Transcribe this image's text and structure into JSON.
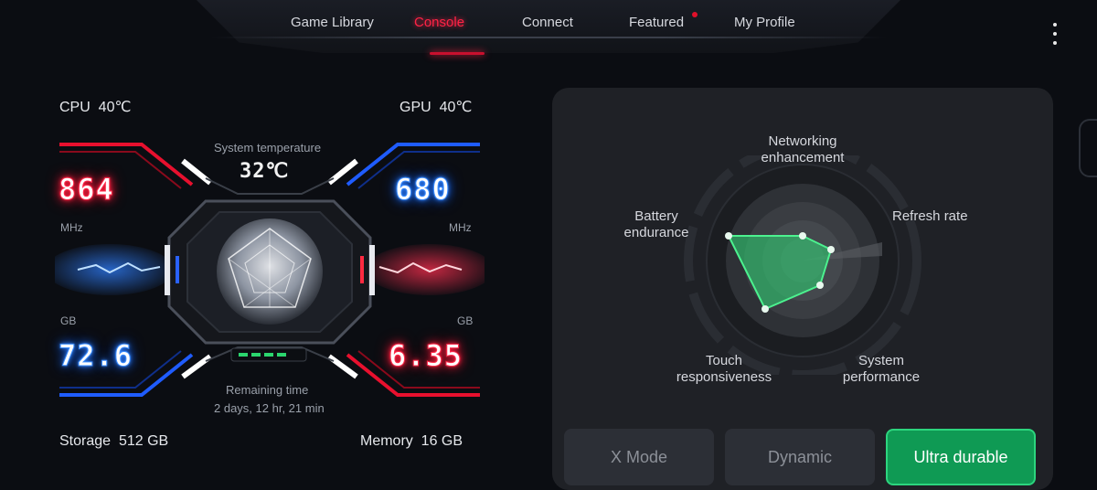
{
  "nav": {
    "tabs": [
      {
        "label": "Game Library"
      },
      {
        "label": "Console"
      },
      {
        "label": "Connect"
      },
      {
        "label": "Featured"
      },
      {
        "label": "My Profile"
      }
    ],
    "active_tab": "Console"
  },
  "dashboard": {
    "cpu": {
      "label": "CPU",
      "temp": "40℃",
      "freq": "864",
      "unit": "MHz"
    },
    "gpu": {
      "label": "GPU",
      "temp": "40℃",
      "freq": "680",
      "unit": "MHz"
    },
    "system_temp": {
      "label": "System temperature",
      "value": "32℃"
    },
    "storage": {
      "value": "72.6",
      "unit": "GB",
      "label": "Storage",
      "total": "512 GB"
    },
    "memory": {
      "value": "6.35",
      "unit": "GB",
      "label": "Memory",
      "total": "16 GB"
    },
    "remaining": {
      "label": "Remaining time",
      "value": "2 days, 12 hr, 21 min"
    },
    "colors": {
      "cpu_accent": "#ff2040",
      "gpu_accent": "#2070ff"
    }
  },
  "radar": {
    "labels": {
      "networking": "Networking\nenhancement",
      "refresh": "Refresh rate",
      "system": "System\nperformance",
      "touch": "Touch\nresponsiveness",
      "battery": "Battery\nendurance"
    },
    "color": "#2ecc71"
  },
  "modes": {
    "items": [
      {
        "label": "X Mode"
      },
      {
        "label": "Dynamic"
      },
      {
        "label": "Ultra durable"
      }
    ],
    "active": "Ultra durable"
  }
}
